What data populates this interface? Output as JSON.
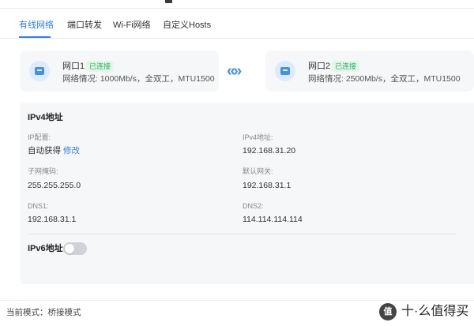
{
  "tabs": [
    {
      "label": "有线网络",
      "active": true
    },
    {
      "label": "端口转发",
      "active": false
    },
    {
      "label": "Wi-Fi网络",
      "active": false
    },
    {
      "label": "自定义Hosts",
      "active": false
    }
  ],
  "ports": [
    {
      "name": "网口1",
      "status": "已连接",
      "info": "网络情况: 1000Mb/s，全双工，MTU1500"
    },
    {
      "name": "网口2",
      "status": "已连接",
      "info": "网络情况: 2500Mb/s，全双工，MTU1500"
    }
  ],
  "link_symbol": "«»",
  "ipv4": {
    "title": "IPv4地址",
    "ip_config_label": "IP配置:",
    "ip_config_value": "自动获得",
    "edit_label": "修改",
    "ipv4_address_label": "IPv4地址:",
    "ipv4_address_value": "192.168.31.20",
    "subnet_label": "子网掩码:",
    "subnet_value": "255.255.255.0",
    "gateway_label": "默认网关:",
    "gateway_value": "192.168.31.1",
    "dns1_label": "DNS1:",
    "dns1_value": "192.168.31.1",
    "dns2_label": "DNS2:",
    "dns2_value": "114.114.114.114"
  },
  "ipv6": {
    "title": "IPv6地址",
    "enabled": false
  },
  "footer": {
    "mode_text": "当前模式：桥接模式"
  },
  "watermark": {
    "badge": "值",
    "text": "十·么值得买"
  },
  "colors": {
    "accent": "#2f80ed",
    "connected": "#27ae60",
    "card_bg": "#f6f7f9"
  }
}
